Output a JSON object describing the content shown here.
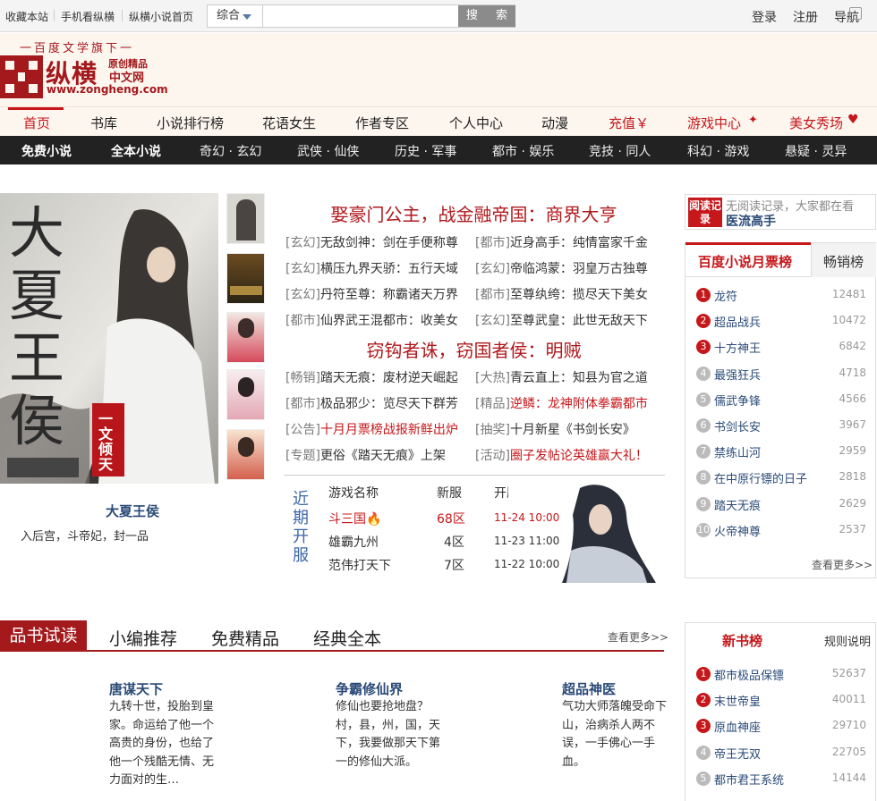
{
  "topbar": {
    "links": [
      "收藏本站",
      "手机看纵横",
      "纵横小说首页"
    ],
    "search_category": "综合",
    "search_placeholder": "",
    "search_button": "搜 索",
    "login": "登录",
    "register": "注册",
    "guide": "导航"
  },
  "header": {
    "slogan": "一百度文学旗下一",
    "logo_text": "纵横",
    "logo_sub1": "原创精品",
    "logo_sub2": "中文网",
    "logo_url": "www.zongheng.com"
  },
  "main_nav": [
    "首页",
    "书库",
    "小说排行榜",
    "花语女生",
    "作者专区",
    "个人中心",
    "动漫",
    "充值￥",
    "游戏中心",
    "美女秀场"
  ],
  "sub_nav": [
    "免费小说",
    "全本小说",
    "奇幻 · 玄幻",
    "武侠 · 仙侠",
    "历史 · 军事",
    "都市 · 娱乐",
    "竞技 · 同人",
    "科幻 · 游戏",
    "悬疑 · 灵异"
  ],
  "hero": {
    "title": "大夏王侯",
    "desc": "入后宫，斗帝妃，封一品",
    "cover_text": "大夏王侯",
    "cover_tag": "一文倾天下"
  },
  "news": {
    "headline1": "娶豪门公主，战金融帝国：商界大亨",
    "headline2": "窃钩者诛，窃国者侯：明贼",
    "rows1": [
      {
        "tag": "[玄幻]",
        "text": "无敌剑神：剑在手便称尊"
      },
      {
        "tag": "[都市]",
        "text": "近身高手：纯情富家千金"
      },
      {
        "tag": "[玄幻]",
        "text": "横压九界天骄：五行天域"
      },
      {
        "tag": "[玄幻]",
        "text": "帝临鸿蒙：羽皇万古独尊"
      },
      {
        "tag": "[玄幻]",
        "text": "丹符至尊：称霸诸天万界"
      },
      {
        "tag": "[都市]",
        "text": "至尊纨绔：揽尽天下美女"
      },
      {
        "tag": "[都市]",
        "text": "仙界武王混都市：收美女"
      },
      {
        "tag": "[玄幻]",
        "text": "至尊武皇：此世无敌天下"
      }
    ],
    "rows2": [
      {
        "tag": "[畅销]",
        "text": "踏天无痕：废材逆天崛起"
      },
      {
        "tag": "[大热]",
        "text": "青云直上：知县为官之道"
      },
      {
        "tag": "[都市]",
        "text": "极品邪少：览尽天下群芳"
      },
      {
        "tag": "[精品]",
        "text": "逆鳞：龙神附体拳霸都市"
      },
      {
        "tag": "[公告]",
        "text": "十月月票榜战报新鲜出炉"
      },
      {
        "tag": "[抽奖]",
        "text": "十月新星《书剑长安》"
      },
      {
        "tag": "[专题]",
        "text": "更俗《踏天无痕》上架"
      },
      {
        "tag": "[活动]",
        "text": "圈子发帖论英雄赢大礼！"
      }
    ]
  },
  "games": {
    "label": "近期开服",
    "headers": [
      "游戏名称",
      "新服",
      "开服时间"
    ],
    "rows": [
      {
        "name": "斗三国",
        "server": "68区",
        "time": "11-24 10:00"
      },
      {
        "name": "雄霸九州",
        "server": "4区",
        "time": "11-23 11:00"
      },
      {
        "name": "范伟打天下",
        "server": "7区",
        "time": "11-22 10:00"
      }
    ]
  },
  "reading": {
    "tag": "阅读记录",
    "message": "无阅读记录，大家都在看",
    "book": "医流高手"
  },
  "monthly_rank": {
    "tabs": [
      "百度小说月票榜",
      "畅销榜"
    ],
    "items": [
      {
        "no": "1",
        "name": "龙符",
        "count": "12481"
      },
      {
        "no": "2",
        "name": "超品战兵",
        "count": "10472"
      },
      {
        "no": "3",
        "name": "十方神王",
        "count": "6842"
      },
      {
        "no": "4",
        "name": "最强狂兵",
        "count": "4718"
      },
      {
        "no": "5",
        "name": "儒武争锋",
        "count": "4566"
      },
      {
        "no": "6",
        "name": "书剑长安",
        "count": "3967"
      },
      {
        "no": "7",
        "name": "禁练山河",
        "count": "2959"
      },
      {
        "no": "8",
        "name": "在中原行镖的日子",
        "count": "2818"
      },
      {
        "no": "9",
        "name": "踏天无痕",
        "count": "2629"
      },
      {
        "no": "10",
        "name": "火帝神尊",
        "count": "2537"
      }
    ],
    "more": "查看更多>>"
  },
  "new_rank": {
    "tabs": [
      "新书榜",
      "规则说明"
    ],
    "items": [
      {
        "no": "1",
        "name": "都市极品保镖",
        "count": "52637"
      },
      {
        "no": "2",
        "name": "末世帝皇",
        "count": "40011"
      },
      {
        "no": "3",
        "name": "原血神座",
        "count": "29710"
      },
      {
        "no": "4",
        "name": "帝王无双",
        "count": "22705"
      },
      {
        "no": "5",
        "name": "都市君王系统",
        "count": "14144"
      }
    ]
  },
  "section": {
    "tabs": [
      "品书试读",
      "小编推荐",
      "免费精品",
      "经典全本"
    ],
    "more": "查看更多>>",
    "books": [
      {
        "title": "唐谋天下",
        "desc": "九转十世，投胎到皇家。命运给了他一个高贵的身份，也给了他一个残酷无情、无力面对的生…"
      },
      {
        "title": "争霸修仙界",
        "desc": "修仙也要抢地盘？村，县，州，国，天下，我要做那天下第一的修仙大派。"
      },
      {
        "title": "超品神医",
        "desc": "气功大师落魄受命下山，治病杀人两不误，一手佛心一手血。"
      }
    ]
  },
  "colors": {
    "brand": "#a3191c",
    "accent": "#c6171b",
    "link": "#2a4a78"
  }
}
